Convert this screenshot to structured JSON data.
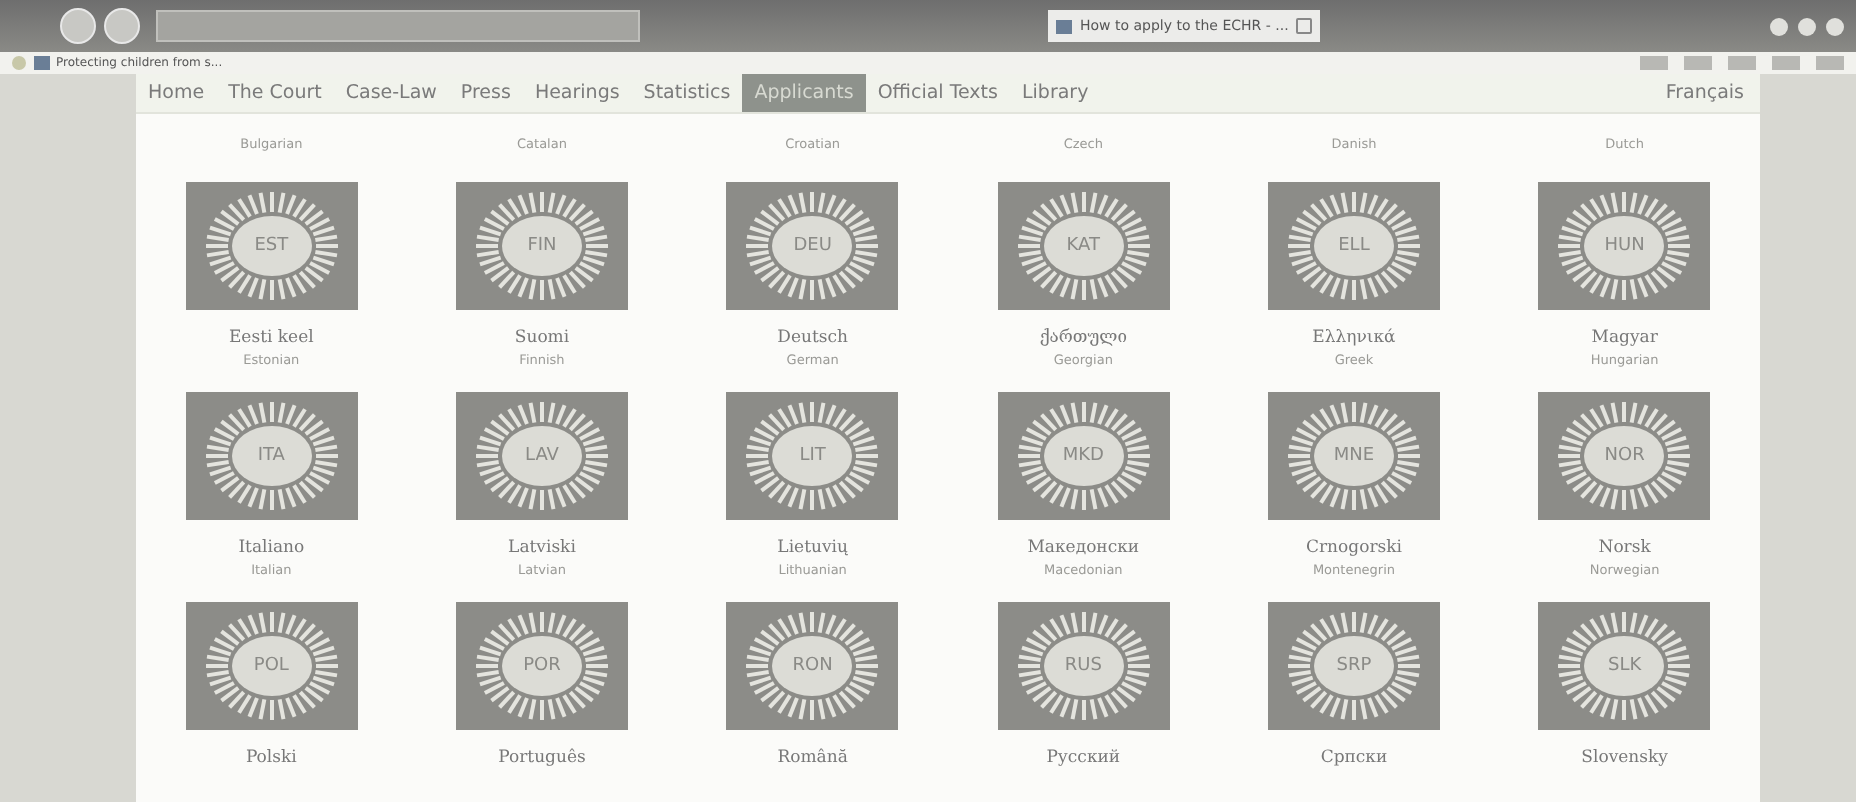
{
  "browser": {
    "tabs": [
      {
        "label": "How to apply to the ECHR - ...",
        "selected": true
      }
    ],
    "favorites": [
      "Protecting children from s..."
    ]
  },
  "nav": [
    {
      "label": "Home",
      "selected": false
    },
    {
      "label": "The Court",
      "selected": false
    },
    {
      "label": "Case-Law",
      "selected": false
    },
    {
      "label": "Press",
      "selected": false
    },
    {
      "label": "Hearings",
      "selected": false
    },
    {
      "label": "Statistics",
      "selected": false
    },
    {
      "label": "Applicants",
      "selected": true
    },
    {
      "label": "Official Texts",
      "selected": false
    },
    {
      "label": "Library",
      "selected": false
    }
  ],
  "language_switch": "Français",
  "top_row": [
    "Bulgarian",
    "Catalan",
    "Croatian",
    "Czech",
    "Danish",
    "Dutch"
  ],
  "languages": [
    {
      "code": "EST",
      "native": "Eesti keel",
      "english": "Estonian"
    },
    {
      "code": "FIN",
      "native": "Suomi",
      "english": "Finnish"
    },
    {
      "code": "DEU",
      "native": "Deutsch",
      "english": "German"
    },
    {
      "code": "KAT",
      "native": "ქართული",
      "english": "Georgian"
    },
    {
      "code": "ELL",
      "native": "Ελληνικά",
      "english": "Greek"
    },
    {
      "code": "HUN",
      "native": "Magyar",
      "english": "Hungarian"
    },
    {
      "code": "ITA",
      "native": "Italiano",
      "english": "Italian"
    },
    {
      "code": "LAV",
      "native": "Latviski",
      "english": "Latvian"
    },
    {
      "code": "LIT",
      "native": "Lietuvių",
      "english": "Lithuanian"
    },
    {
      "code": "MKD",
      "native": "Македонски",
      "english": "Macedonian"
    },
    {
      "code": "MNE",
      "native": "Crnogorski",
      "english": "Montenegrin"
    },
    {
      "code": "NOR",
      "native": "Norsk",
      "english": "Norwegian"
    },
    {
      "code": "POL",
      "native": "Polski"
    },
    {
      "code": "POR",
      "native": "Português"
    },
    {
      "code": "RON",
      "native": "Română"
    },
    {
      "code": "RUS",
      "native": "Русский"
    },
    {
      "code": "SRP",
      "native": "Српски"
    },
    {
      "code": "SLK",
      "native": "Slovensky"
    }
  ]
}
